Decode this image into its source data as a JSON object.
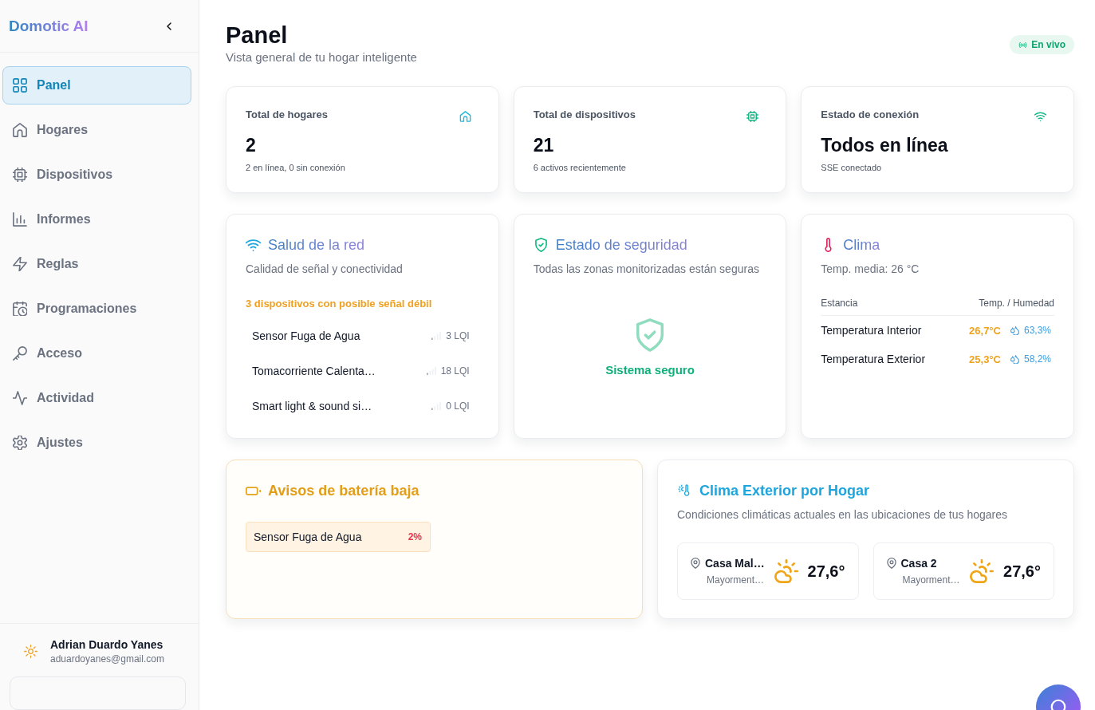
{
  "sidebar": {
    "brand": "Domotic AI",
    "items": [
      {
        "label": "Panel",
        "selected": true
      },
      {
        "label": "Hogares",
        "selected": false
      },
      {
        "label": "Dispositivos",
        "selected": false
      },
      {
        "label": "Informes",
        "selected": false
      },
      {
        "label": "Reglas",
        "selected": false
      },
      {
        "label": "Programaciones",
        "selected": false
      },
      {
        "label": "Acceso",
        "selected": false
      },
      {
        "label": "Actividad",
        "selected": false
      },
      {
        "label": "Ajustes",
        "selected": false
      }
    ],
    "user": {
      "name": "Adrian Duardo Yanes",
      "email": "aduardoyanes@gmail.com"
    }
  },
  "header": {
    "title": "Panel",
    "subtitle": "Vista general de tu hogar inteligente",
    "status_badge": "En vivo"
  },
  "stat_cards": [
    {
      "label": "Total de hogares",
      "value": "2",
      "note": "2 en línea, 0 sin conexión"
    },
    {
      "label": "Total de dispositivos",
      "value": "21",
      "note": "6 activos recientemente"
    },
    {
      "label": "Estado de conexión",
      "value": "Todos en línea",
      "note": "SSE conectado"
    }
  ],
  "network_health": {
    "title": "Salud de la red",
    "subtitle": "Calidad de señal y conectividad",
    "warning": "3 dispositivos con posible señal débil",
    "devices": [
      {
        "name": "Sensor Fuga de Agua",
        "reading": "3 LQI"
      },
      {
        "name": "Tomacorriente Calenta…",
        "reading": "18 LQI"
      },
      {
        "name": "Smart light & sound si…",
        "reading": "0 LQI"
      }
    ]
  },
  "security": {
    "title": "Estado de seguridad",
    "subtitle": "Todas las zonas monitorizadas están seguras",
    "status": "Sistema seguro"
  },
  "climate": {
    "title": "Clima",
    "subtitle": "Temp. media: 26 °C",
    "columns": [
      "Estancia",
      "Temp. / Humedad"
    ],
    "rows": [
      {
        "name": "Temperatura Interior",
        "temperature": "26,7°C",
        "humidity": "63,3%"
      },
      {
        "name": "Temperatura Exterior",
        "temperature": "25,3°C",
        "humidity": "58,2%"
      }
    ]
  },
  "battery_alerts": {
    "title": "Avisos de batería baja",
    "items": [
      {
        "name": "Sensor Fuga de Agua",
        "reading": "2%"
      }
    ]
  },
  "outdoor_climate": {
    "title": "Clima Exterior por Hogar",
    "subtitle": "Condiciones climáticas actuales en las ubicaciones de tus hogares",
    "homes": [
      {
        "name": "Casa Mal…",
        "condition": "Mayorment…",
        "temperature": "27,6°"
      },
      {
        "name": "Casa 2",
        "condition": "Mayorment…",
        "temperature": "27,6°"
      }
    ]
  }
}
